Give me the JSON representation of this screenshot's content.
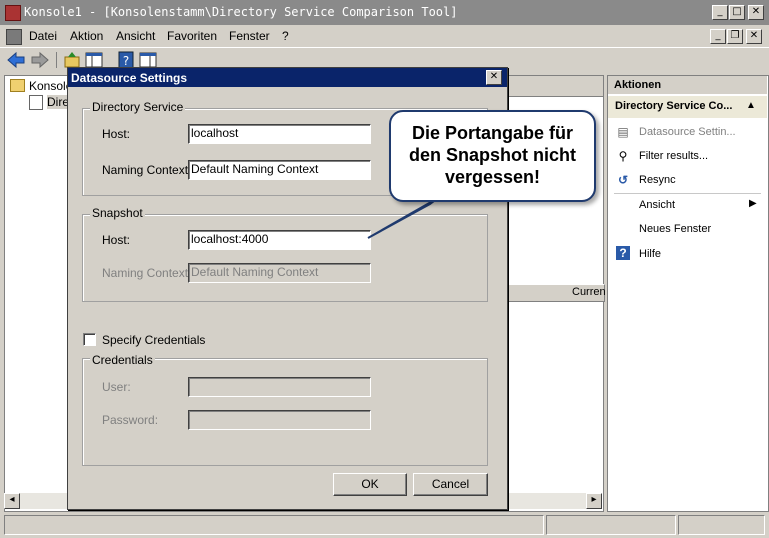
{
  "window": {
    "title": "Konsole1 - [Konsolenstamm\\Directory Service Comparison Tool]",
    "min_glyph": "_",
    "max_glyph": "□",
    "close_glyph": "✕",
    "restore_glyph": "❐"
  },
  "menu": {
    "items": [
      "Datei",
      "Aktion",
      "Ansicht",
      "Favoriten",
      "Fenster",
      "?"
    ]
  },
  "tree": {
    "root_label": "Konsole",
    "child_label": "Dire"
  },
  "middle": {
    "column_header": "Curren"
  },
  "dialog": {
    "title": "Datasource Settings",
    "close_glyph": "✕",
    "directory_service": {
      "legend": "Directory Service",
      "host_label": "Host:",
      "host_value": "localhost",
      "naming_label": "Naming Context:",
      "naming_value": "Default Naming Context"
    },
    "snapshot": {
      "legend": "Snapshot",
      "host_label": "Host:",
      "host_value": "localhost:4000",
      "naming_label": "Naming Context:",
      "naming_value": "Default Naming Context"
    },
    "specify_credentials": "Specify Credentials",
    "credentials": {
      "legend": "Credentials",
      "user_label": "User:",
      "user_value": "",
      "password_label": "Password:",
      "password_value": ""
    },
    "ok_label": "OK",
    "cancel_label": "Cancel"
  },
  "callout": {
    "line1": "Die Portangabe für",
    "line2": "den Snapshot nicht",
    "line3": "vergessen!"
  },
  "actions": {
    "header": "Aktionen",
    "section": "Directory Service Co...",
    "items": [
      {
        "label": "Datasource Settin...",
        "icon": "datasource-icon",
        "disabled": true
      },
      {
        "label": "Filter results...",
        "icon": "filter-icon",
        "disabled": false
      },
      {
        "label": "Resync",
        "icon": "resync-icon",
        "disabled": false
      },
      {
        "label": "Ansicht",
        "icon": "",
        "disabled": false
      },
      {
        "label": "Neues Fenster",
        "icon": "",
        "disabled": false
      },
      {
        "label": "Hilfe",
        "icon": "help-icon",
        "disabled": false
      }
    ]
  },
  "colors": {
    "dialog_title_bg": "#0a246a",
    "callout_border": "#1f3a6e",
    "inactive_title_bg": "#8a8a8a"
  }
}
